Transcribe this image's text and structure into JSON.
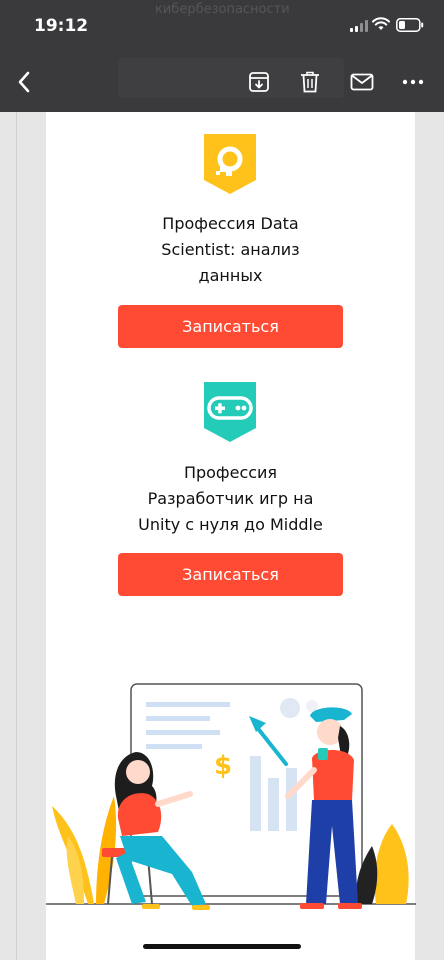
{
  "status_bar": {
    "time": "19:12",
    "background_text": "кибербезопасности",
    "icons": [
      "signal-icon",
      "wifi-icon",
      "battery-icon"
    ]
  },
  "toolbar": {
    "icons": [
      "back-icon",
      "archive-icon",
      "trash-icon",
      "mail-icon",
      "more-icon"
    ]
  },
  "courses": [
    {
      "title": "Профессия Data\nScientist: анализ\nданных",
      "button_label": "Записаться",
      "icon": "data-science-badge-icon",
      "color": "#ffc21a"
    },
    {
      "title": "Профессия\nРазработчик игр на\nUnity с нуля до Middle",
      "button_label": "Записаться",
      "icon": "gamepad-badge-icon",
      "color": "#24cbb9"
    }
  ],
  "illustration": {
    "currency_symbol": "$"
  },
  "colors": {
    "accent": "#ff4b33",
    "topbar": "#3a3a3c",
    "yellow": "#ffc21a",
    "teal": "#24cbb9"
  }
}
